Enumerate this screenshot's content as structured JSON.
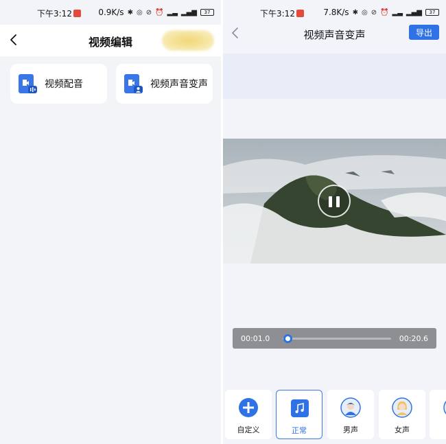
{
  "left": {
    "status": {
      "time": "下午3:12",
      "net_speed": "0.9K/s",
      "battery": "37"
    },
    "header": {
      "title": "视频编辑"
    },
    "cards": [
      {
        "label": "视频配音",
        "icon": "video-dub-icon"
      },
      {
        "label": "视频声音变声",
        "icon": "video-voice-change-icon"
      }
    ]
  },
  "right": {
    "status": {
      "time": "下午3:12",
      "net_speed": "7.8K/s",
      "battery": "37"
    },
    "header": {
      "title": "视频声音变声",
      "export_label": "导出"
    },
    "player": {
      "state": "playing",
      "current_time": "00:01.0",
      "total_time": "00:20.6",
      "progress": 0.048
    },
    "voices": [
      {
        "label": "自定义",
        "icon": "plus-circle-icon",
        "selected": false
      },
      {
        "label": "正常",
        "icon": "music-note-icon",
        "selected": true
      },
      {
        "label": "男声",
        "icon": "male-avatar-icon",
        "selected": false
      },
      {
        "label": "女声",
        "icon": "female-avatar-icon",
        "selected": false
      }
    ]
  },
  "colors": {
    "accent": "#2f72e6",
    "background": "#f3f4f8",
    "status_badge": "#e24a3b"
  }
}
